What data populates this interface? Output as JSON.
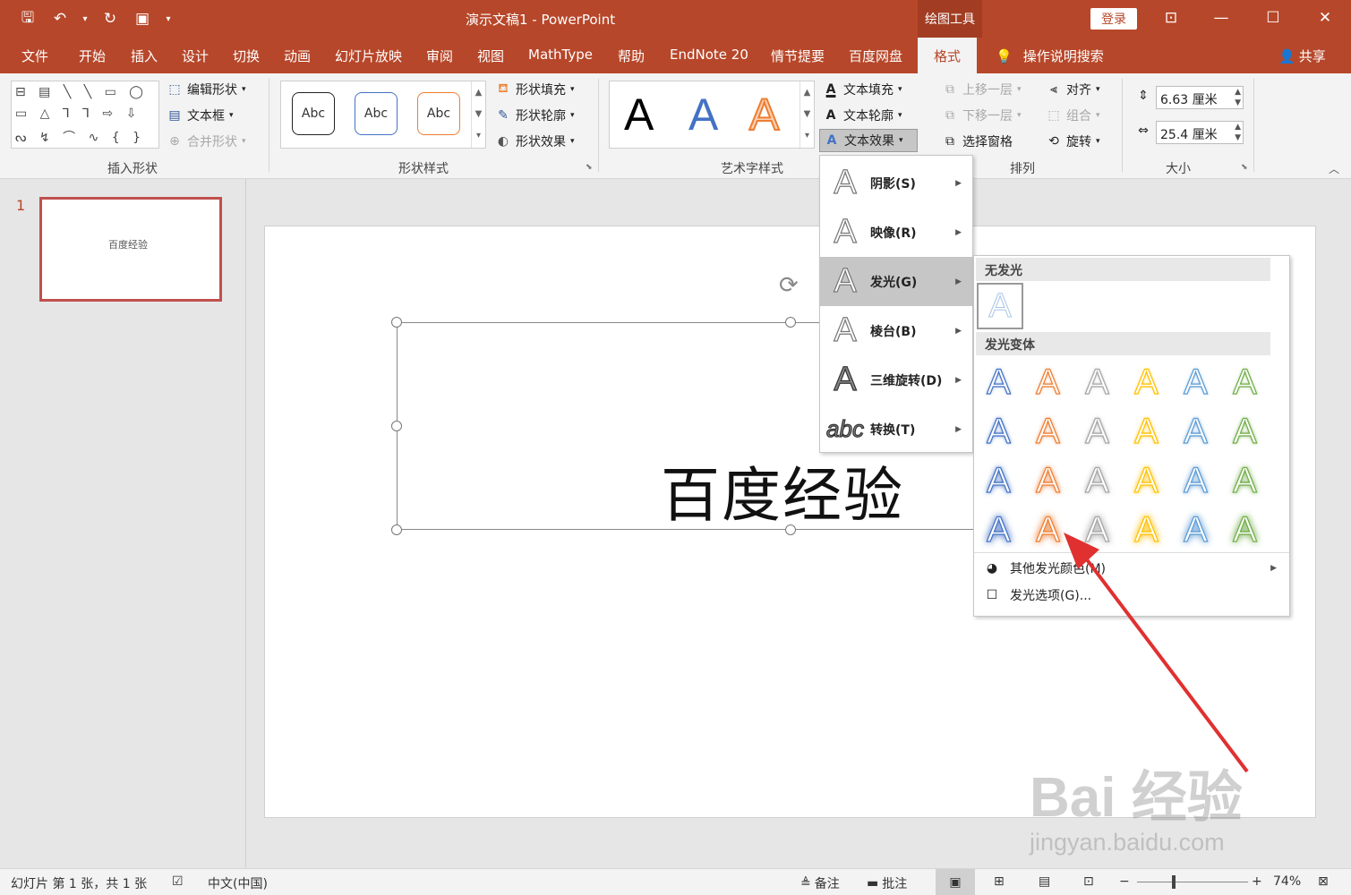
{
  "window": {
    "title": "演示文稿1  -  PowerPoint",
    "context_tab": "绘图工具",
    "login": "登录",
    "controls": {
      "ribbon_display": "⊡",
      "minimize": "—",
      "maximize": "☐",
      "close": "✕"
    }
  },
  "qat": {
    "save": "🖫",
    "undo": "↶",
    "undo_more": "▾",
    "redo": "↻",
    "present": "▣",
    "customize": "▾"
  },
  "tabs": [
    "文件",
    "开始",
    "插入",
    "设计",
    "切换",
    "动画",
    "幻灯片放映",
    "审阅",
    "视图",
    "MathType",
    "帮助",
    "EndNote 20",
    "情节提要",
    "百度网盘"
  ],
  "active_tab": "格式",
  "tell_me": {
    "icon": "💡",
    "label": "操作说明搜索"
  },
  "share": {
    "icon": "👤",
    "label": "共享"
  },
  "ribbon": {
    "insert_shapes": {
      "label": "插入形状",
      "shape_rows": [
        "⊟ ▤ ╲ ╲ ▭ ◯",
        "▭ △ ⅂ ⅂ ⇨ ⇩",
        "ᔓ ↯ ⌒ ∿ { }"
      ],
      "edit_shape": "编辑形状",
      "text_box": "文本框",
      "merge_shapes": "合并形状"
    },
    "shape_styles": {
      "label": "形状样式",
      "samples": [
        "Abc",
        "Abc",
        "Abc"
      ],
      "fill": "形状填充",
      "outline": "形状轮廓",
      "effects": "形状效果"
    },
    "wordart_styles": {
      "label": "艺术字样式",
      "samples": [
        "A",
        "A",
        "A"
      ],
      "text_fill": "文本填充",
      "text_outline": "文本轮廓",
      "text_effects": "文本效果"
    },
    "arrange": {
      "label": "排列",
      "bring_forward": "上移一层",
      "send_backward": "下移一层",
      "selection_pane": "选择窗格",
      "align": "对齐",
      "group": "组合",
      "rotate": "旋转"
    },
    "size": {
      "label": "大小",
      "height": "6.63 厘米",
      "width": "25.4 厘米"
    }
  },
  "thumbnails": [
    {
      "number": "1",
      "text": "百度经验"
    }
  ],
  "slide": {
    "text": "百度经验"
  },
  "text_effects_menu": [
    {
      "label": "阴影(S)",
      "selected": false
    },
    {
      "label": "映像(R)",
      "selected": false
    },
    {
      "label": "发光(G)",
      "selected": true
    },
    {
      "label": "棱台(B)",
      "selected": false
    },
    {
      "label": "三维旋转(D)",
      "selected": false
    },
    {
      "label": "转换(T)",
      "selected": false
    }
  ],
  "glow_submenu": {
    "no_glow_header": "无发光",
    "variants_header": "发光变体",
    "variant_colors": [
      "#4472c4",
      "#ed7d31",
      "#a5a5a5",
      "#ffc000",
      "#5b9bd5",
      "#70ad47"
    ],
    "variant_rows": 4,
    "more_colors": "其他发光颜色(M)",
    "options": "发光选项(G)..."
  },
  "watermark": {
    "brand": "Bai 经验",
    "url": "jingyan.baidu.com"
  },
  "statusbar": {
    "slide_info": "幻灯片 第 1 张，共 1 张",
    "language": "中文(中国)",
    "notes": "备注",
    "comments": "批注",
    "zoom_minus": "−",
    "zoom_plus": "+",
    "zoom": "74%"
  },
  "colors": {
    "accent": "#b7472a",
    "arrow": "#e03030"
  }
}
